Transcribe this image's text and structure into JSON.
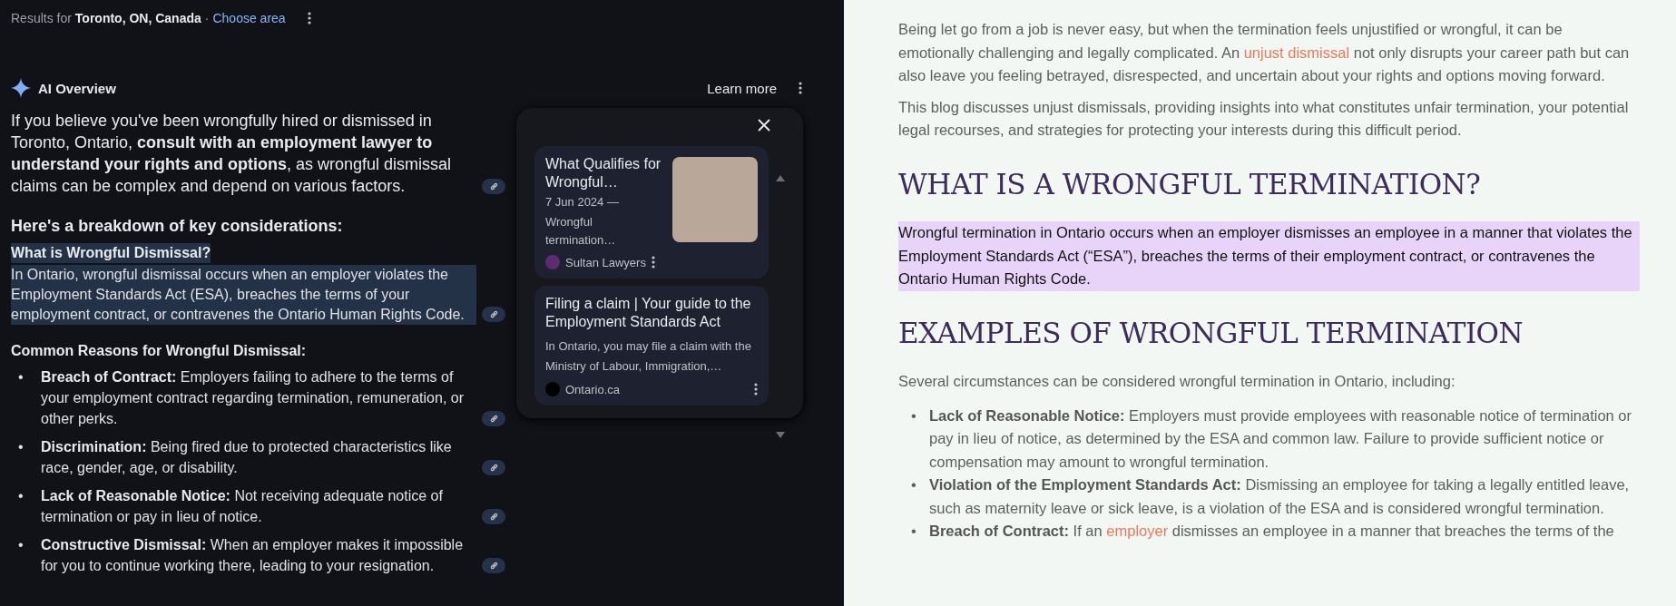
{
  "location_bar": {
    "prefix": "Results for",
    "location": "Toronto, ON, Canada",
    "separator": "·",
    "link": "Choose area"
  },
  "ai_overview": {
    "title": "AI Overview",
    "learn_more": "Learn more",
    "intro": "If you believe you've been wrongfully hired or dismissed in Toronto, Ontario, **consult with an employment lawyer to understand your rights and options**, as wrongful dismissal claims can be complex and depend on various factors.",
    "breakdown_heading": "Here's a breakdown of key considerations:",
    "definition": {
      "heading": "What is Wrongful Dismissal?",
      "text": "In Ontario, wrongful dismissal occurs when an employer violates the Employment Standards Act (ESA), breaches the terms of your employment contract, or contravenes the Ontario Human Rights Code.",
      "highlighted": true
    },
    "reasons": {
      "heading": "Common Reasons for Wrongful Dismissal:",
      "marker": "•",
      "items": [
        {
          "text": "**Breach of Contract:** Employers failing to adhere to the terms of your employment contract regarding termination, remuneration, or other perks."
        },
        {
          "text": "**Discrimination:** Being fired due to protected characteristics like race, gender, age, or disability."
        },
        {
          "text": "**Lack of Reasonable Notice:** Not receiving adequate notice of termination or pay in lieu of notice."
        },
        {
          "text": "**Constructive Dismissal:** When an employer makes it impossible for you to continue working there, leading to your resignation."
        }
      ]
    },
    "sources": [
      {
        "kind": "with_image",
        "title": "What Qualifies for Wrongful…",
        "date": "7 Jun 2024 —",
        "snippet": "Wrongful termination…",
        "site": "Sultan Lawyers",
        "color": "#5b2d6e"
      },
      {
        "kind": "text",
        "title": "Filing a claim | Your guide to the Employment Standards Act",
        "snippet": "In Ontario, you may file a claim with the Ministry of Labour, Immigration,…",
        "site": "Ontario.ca",
        "color": "#000000"
      }
    ]
  },
  "article": {
    "blocks": [
      {
        "kind": "paragraph",
        "highlighted": false,
        "parts": [
          {
            "kind": "text",
            "text": "Being let go from a job is never easy, but when the termination feels unjustified or wrongful, it can be emotionally challenging and legally complicated. An "
          },
          {
            "kind": "link",
            "text": "unjust dismissal"
          },
          {
            "kind": "text",
            "text": " not only disrupts your career path but can also leave you feeling betrayed, disrespected, and uncertain about your rights and options moving forward."
          }
        ]
      },
      {
        "kind": "paragraph",
        "highlighted": false,
        "parts": [
          {
            "kind": "text",
            "text": "This blog discusses unjust dismissals, providing insights into what constitutes unfair termination, your potential legal recourses, and strategies for protecting your interests during this difficult period."
          }
        ]
      },
      {
        "kind": "heading",
        "text": "WHAT IS A WRONGFUL TERMINATION?"
      },
      {
        "kind": "paragraph",
        "highlighted": true,
        "parts": [
          {
            "kind": "text",
            "text": "Wrongful termination in Ontario occurs when an employer dismisses an employee in a manner that violates the Employment Standards Act (“ESA”), breaches the terms of their employment contract, or contravenes the Ontario Human Rights Code."
          }
        ]
      },
      {
        "kind": "heading",
        "text": "EXAMPLES OF WRONGFUL TERMINATION"
      },
      {
        "kind": "paragraph",
        "highlighted": false,
        "parts": [
          {
            "kind": "text",
            "text": "Several circumstances can be considered wrongful termination in Ontario, including:"
          }
        ]
      },
      {
        "kind": "list",
        "marker": "•",
        "items": [
          {
            "parts": [
              {
                "kind": "text",
                "text": "**Lack of Reasonable Notice:** Employers must provide employees with reasonable notice of termination or pay in lieu of notice, as determined by the ESA and common law. Failure to provide sufficient notice or compensation may amount to wrongful termination."
              }
            ]
          },
          {
            "parts": [
              {
                "kind": "text",
                "text": "**Violation of the Employment Standards Act:** Dismissing an employee for taking a legally entitled leave, such as maternity leave or sick leave, is a violation of the ESA and is considered wrongful termination."
              }
            ]
          },
          {
            "parts": [
              {
                "kind": "text",
                "text": "**Breach of Contract:** If an "
              },
              {
                "kind": "link",
                "text": "employer"
              },
              {
                "kind": "text",
                "text": " dismisses an employee in a manner that breaches the terms of the"
              }
            ]
          }
        ]
      }
    ]
  }
}
